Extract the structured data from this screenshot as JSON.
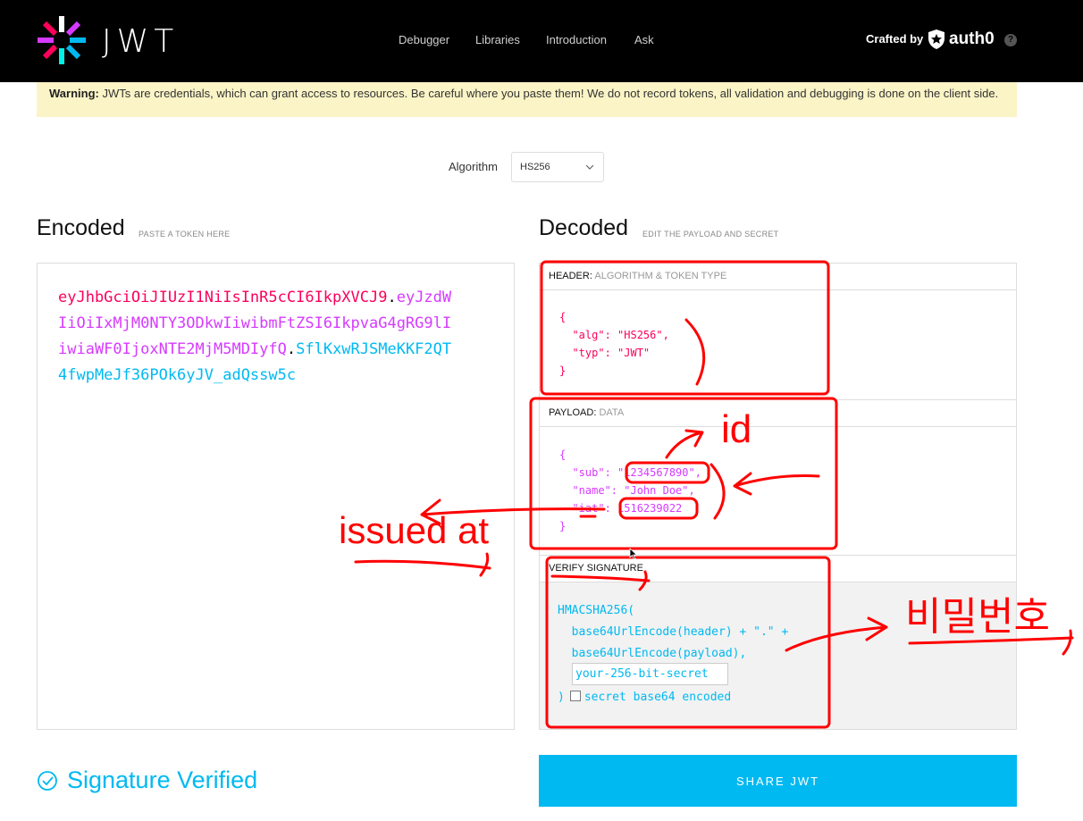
{
  "app": {
    "logo_text": "JWT"
  },
  "nav": [
    "Debugger",
    "Libraries",
    "Introduction",
    "Ask"
  ],
  "crafted_by": {
    "label": "Crafted by",
    "brand": "auth0",
    "help": "?"
  },
  "warning": {
    "bold": "Warning:",
    "text": " JWTs are credentials, which can grant access to resources. Be careful where you paste them! We do not record tokens, all validation and debugging is done on the client side."
  },
  "algorithm": {
    "label": "Algorithm",
    "value": "HS256"
  },
  "encoded": {
    "title": "Encoded",
    "subtitle": "PASTE A TOKEN HERE",
    "header_part": "eyJhbGciOiJIUzI1NiIsInR5cCI6IkpXVCJ9",
    "payload_part": "eyJzdWIiOiIxMjM0NTY3ODkwIiwibmFtZSI6IkpvaG4gRG9lIiwiaWF0IjoxNTE2MjM5MDIyfQ",
    "signature_part": "SflKxwRJSMeKKF2QT4fwpMeJf36POk6yJV_adQssw5c",
    "dot": "."
  },
  "decoded": {
    "title": "Decoded",
    "subtitle": "EDIT THE PAYLOAD AND SECRET",
    "header": {
      "label": "HEADER:",
      "desc": "ALGORITHM & TOKEN TYPE",
      "json": "{\n  \"alg\": \"HS256\",\n  \"typ\": \"JWT\"\n}"
    },
    "payload": {
      "label": "PAYLOAD:",
      "desc": "DATA",
      "json": "{\n  \"sub\": \"1234567890\",\n  \"name\": \"John Doe\",\n  \"iat\": 1516239022\n}"
    },
    "signature": {
      "label": "VERIFY SIGNATURE",
      "code": "HMACSHA256(\n  base64UrlEncode(header) + \".\" +\n  base64UrlEncode(payload),",
      "secret": "your-256-bit-secret",
      "close": ")",
      "checkbox_label": "secret base64 encoded"
    }
  },
  "status": {
    "text": "Signature Verified"
  },
  "share_button": "SHARE JWT",
  "annotations": {
    "id": "id",
    "issued_at": "issued at",
    "password": "비밀번호",
    "color": "#ff0000"
  }
}
